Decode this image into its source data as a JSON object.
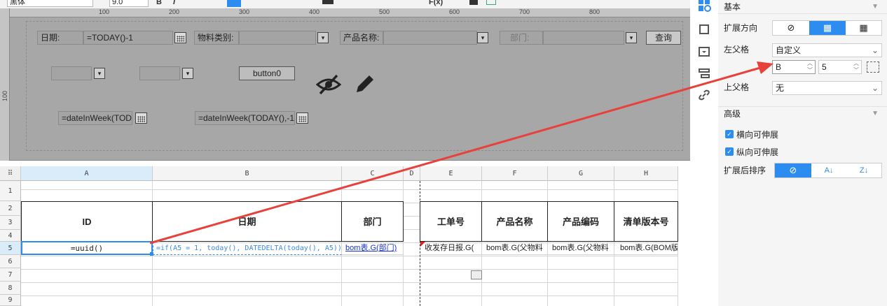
{
  "toolbar": {
    "font_name": "黑体",
    "font_size": "9.0",
    "bold_label": "B",
    "italic_label": "I",
    "formula_label": "F(x)"
  },
  "ruler": {
    "top_ticks": [
      "100",
      "200",
      "300",
      "400",
      "500",
      "600",
      "700",
      "800"
    ],
    "left_ticks": [
      "100"
    ]
  },
  "param_pane": {
    "date_label": "日期:",
    "date_value": "=TODAY()-1",
    "category_label": "物料类别:",
    "product_label": "产品名称:",
    "dept_label": "部门:",
    "query_button": "查询",
    "button0": "button0",
    "week1": "=dateInWeek(TOD.",
    "week2": "=dateInWeek(TODAY(),-1"
  },
  "grid": {
    "columns": [
      "A",
      "B",
      "C",
      "D",
      "E",
      "F",
      "G",
      "H"
    ],
    "rows": [
      "1",
      "2",
      "3",
      "4",
      "5",
      "6",
      "7",
      "8",
      "9"
    ],
    "headers": {
      "id": "ID",
      "date": "日期",
      "dept": "部门",
      "order": "工单号",
      "product_name": "产品名称",
      "product_code": "产品编码",
      "bom_version": "清单版本号"
    },
    "row5": {
      "a": "=uuid()",
      "b": "=if(A5 = 1, today(), DATEDELTA(today(), A5))",
      "c": "bom表.G(部门)",
      "e": "收发存日报.G(",
      "f": "bom表.G(父物料",
      "g": "bom表.G(父物料",
      "h": "bom表.G(BOM版"
    }
  },
  "panel": {
    "basic": "基本",
    "expand_dir_label": "扩展方向",
    "left_parent_label": "左父格",
    "left_parent_value": "自定义",
    "left_parent_col": "B",
    "left_parent_row": "5",
    "top_parent_label": "上父格",
    "top_parent_value": "无",
    "advanced": "高级",
    "h_stretch": "横向可伸展",
    "v_stretch": "纵向可伸展",
    "sort_label": "扩展后排序"
  },
  "colors": {
    "accent": "#2d8cf0",
    "arrow": "#e8413b",
    "formula_blue": "#1a62c8"
  }
}
